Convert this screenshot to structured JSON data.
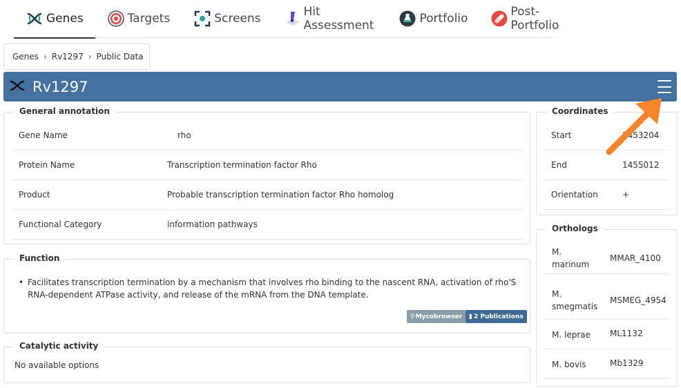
{
  "nav": {
    "tabs": [
      {
        "label": "Genes",
        "icon": "dna-icon",
        "active": true
      },
      {
        "label": "Targets",
        "icon": "target-icon"
      },
      {
        "label": "Screens",
        "icon": "screen-icon"
      },
      {
        "label": "Hit Assessment",
        "icon": "hit-assessment-icon"
      },
      {
        "label": "Portfolio",
        "icon": "flask-icon"
      },
      {
        "label": "Post-Portfolio",
        "icon": "pill-icon"
      }
    ]
  },
  "breadcrumb": [
    "Genes",
    "Rv1297",
    "Public Data"
  ],
  "header": {
    "title": "Rv1297",
    "color": "#4472a0"
  },
  "general_annotation": {
    "title": "General annotation",
    "rows": [
      {
        "key": "Gene Name",
        "value": "rho"
      },
      {
        "key": "Protein Name",
        "value": "Transcription termination factor Rho"
      },
      {
        "key": "Product",
        "value": "Probable transcription termination factor Rho homolog"
      },
      {
        "key": "Functional Category",
        "value": "information pathways"
      }
    ]
  },
  "function": {
    "title": "Function",
    "text": "Facilitates transcription termination by a mechanism that involves rho binding to the nascent RNA, activation of rho'S RNA-dependent ATPase activity, and release of the mRNA from the DNA template.",
    "badges": {
      "mycobrowser": "Mycobrowser",
      "publications": "2 Publications"
    }
  },
  "catalytic_activity": {
    "title": "Catalytic activity",
    "text": "No available options"
  },
  "coordinates": {
    "title": "Coordinates",
    "rows": [
      {
        "key": "Start",
        "value": "1453204"
      },
      {
        "key": "End",
        "value": "1455012"
      },
      {
        "key": "Orientation",
        "value": "+"
      }
    ]
  },
  "orthologs": {
    "title": "Orthologs",
    "rows": [
      {
        "key": "M. marinum",
        "value": "MMAR_4100"
      },
      {
        "key": "M. smegmatis",
        "value": "MSMEG_4954"
      },
      {
        "key": "M. leprae",
        "value": "ML1132"
      },
      {
        "key": "M. bovis",
        "value": "Mb1329"
      }
    ]
  },
  "colors": {
    "header": "#4472a0",
    "annotation_arrow": "#f5862b",
    "mycobrowser_badge": "#8a9ea9",
    "publications_badge": "#3e6b96"
  }
}
